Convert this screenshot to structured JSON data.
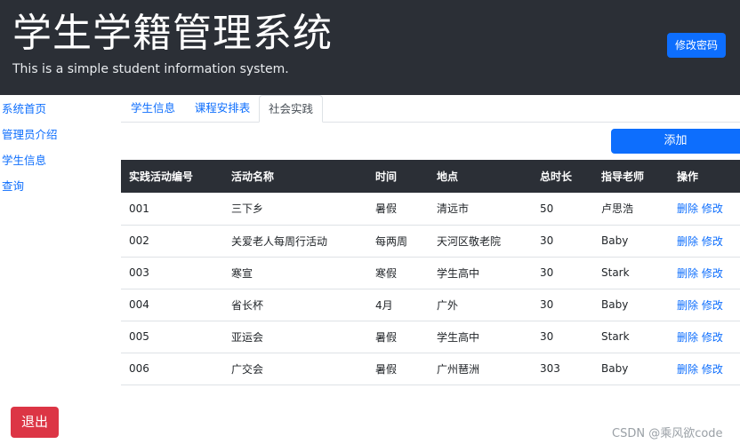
{
  "header": {
    "title": "学生学籍管理系统",
    "subtitle": "This is a simple student information system.",
    "change_password": "修改密码"
  },
  "sidebar": {
    "items": [
      {
        "label": "系统首页"
      },
      {
        "label": "管理员介绍"
      },
      {
        "label": "学生信息"
      },
      {
        "label": "查询"
      }
    ]
  },
  "tabs": [
    {
      "label": "学生信息"
    },
    {
      "label": "课程安排表"
    },
    {
      "label": "社会实践",
      "active": true
    }
  ],
  "toolbar": {
    "add_label": "添加"
  },
  "table": {
    "headers": [
      "实践活动编号",
      "活动名称",
      "时间",
      "地点",
      "总时长",
      "指导老师",
      "操作"
    ],
    "rows": [
      {
        "id": "001",
        "name": "三下乡",
        "time": "暑假",
        "place": "清远市",
        "hours": "50",
        "teacher": "卢思浩"
      },
      {
        "id": "002",
        "name": "关爱老人每周行活动",
        "time": "每两周",
        "place": "天河区敬老院",
        "hours": "30",
        "teacher": "Baby"
      },
      {
        "id": "003",
        "name": "寒宣",
        "time": "寒假",
        "place": "学生高中",
        "hours": "30",
        "teacher": "Stark"
      },
      {
        "id": "004",
        "name": "省长杯",
        "time": "4月",
        "place": "广外",
        "hours": "30",
        "teacher": "Baby"
      },
      {
        "id": "005",
        "name": "亚运会",
        "time": "暑假",
        "place": "学生高中",
        "hours": "30",
        "teacher": "Stark"
      },
      {
        "id": "006",
        "name": "广交会",
        "time": "暑假",
        "place": "广州琶洲",
        "hours": "303",
        "teacher": "Baby"
      }
    ],
    "delete_label": "删除",
    "edit_label": "修改"
  },
  "footer": {
    "logout_label": "退出",
    "watermark": "CSDN @乘风欲code"
  },
  "colors": {
    "header_bg": "#2b2f36",
    "primary": "#0d6efd",
    "danger": "#dc3545"
  }
}
